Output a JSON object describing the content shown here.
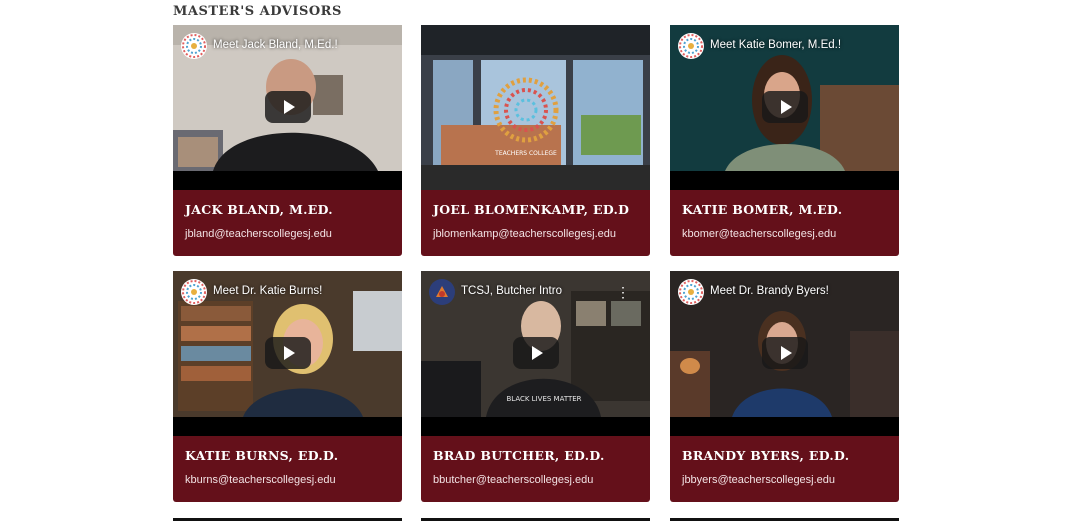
{
  "section": {
    "title": "MASTER'S ADVISORS"
  },
  "advisors": [
    {
      "video_title": "Meet Jack Bland, M.Ed.!",
      "name": "JACK BLAND, M.ED.",
      "email": "jbland@teacherscollegesj.edu"
    },
    {
      "video_title": "",
      "name": "JOEL BLOMENKAMP, ED.D",
      "email": "jblomenkamp@teacherscollegesj.edu"
    },
    {
      "video_title": "Meet Katie Bomer, M.Ed.!",
      "name": "KATIE BOMER, M.ED.",
      "email": "kbomer@teacherscollegesj.edu"
    },
    {
      "video_title": "Meet Dr. Katie Burns!",
      "name": "KATIE BURNS, ED.D.",
      "email": "kburns@teacherscollegesj.edu"
    },
    {
      "video_title": "TCSJ, Butcher Intro",
      "name": "BRAD BUTCHER, ED.D.",
      "email": "bbutcher@teacherscollegesj.edu"
    },
    {
      "video_title": "Meet Dr. Brandy Byers!",
      "name": "BRANDY BYERS, ED.D.",
      "email": "jbbyers@teacherscollegesj.edu"
    }
  ],
  "video_frame_texts": {
    "window_logo": "TEACHERS COLLEGE",
    "shirt": "BLACK LIVES MATTER"
  },
  "icons": {
    "play": "play-button-icon",
    "channel": "tcsj-logo-icon",
    "menu": "more-vert-icon"
  },
  "colors": {
    "card_bg": "#64101a",
    "title": "#3a3a3a"
  }
}
